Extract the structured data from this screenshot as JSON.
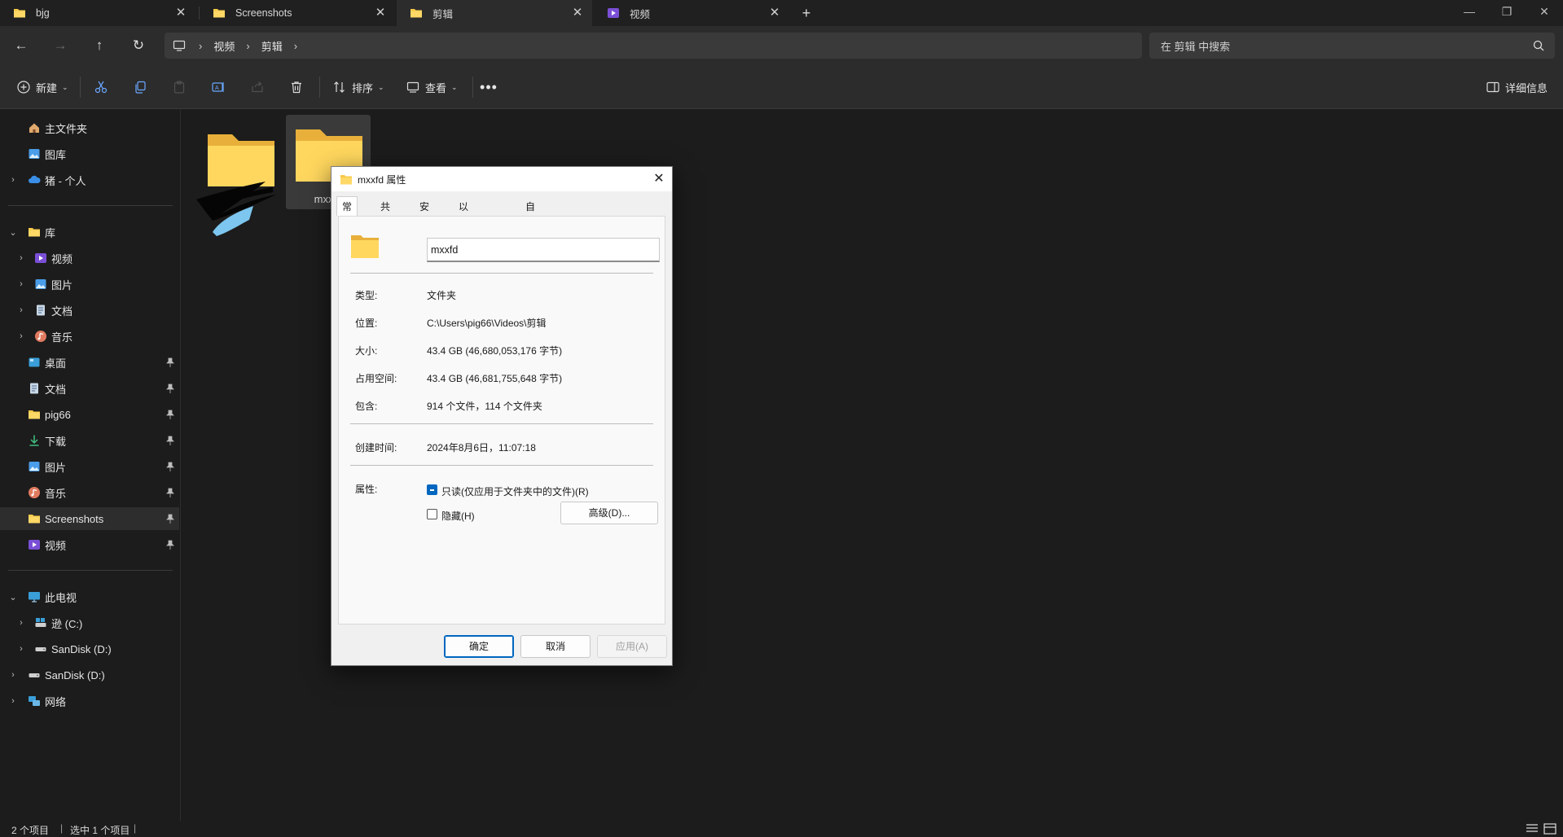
{
  "tabs": [
    {
      "label": "bjg",
      "icon": "folder-icon"
    },
    {
      "label": "Screenshots",
      "icon": "folder-icon"
    },
    {
      "label": "剪辑",
      "icon": "folder-icon"
    },
    {
      "label": "视频",
      "icon": "videos-library-icon"
    }
  ],
  "active_tab_index": 2,
  "breadcrumb": [
    "视频",
    "剪辑"
  ],
  "search": {
    "placeholder": "在 剪辑 中搜索"
  },
  "toolbar": {
    "new_label": "新建",
    "sort_label": "排序",
    "view_label": "查看",
    "details_label": "详细信息"
  },
  "sidebar": {
    "home": "主文件夹",
    "gallery": "图库",
    "onedrive": "猪 - 个人",
    "libraries": "库",
    "lib_items": [
      "视频",
      "图片",
      "文档",
      "音乐"
    ],
    "quick_access": [
      "桌面",
      "文档",
      "pig66",
      "下载",
      "图片",
      "音乐",
      "Screenshots",
      "视频"
    ],
    "this_pc": "此电视",
    "pc_items": [
      "逊 (C:)",
      "SanDisk (D:)"
    ],
    "sandisk": "SanDisk (D:)",
    "network": "网络"
  },
  "files": [
    {
      "name": ""
    },
    {
      "name": "mxxfd"
    }
  ],
  "status": {
    "count": "2 个项目",
    "selected": "选中 1 个项目"
  },
  "dialog": {
    "title": "mxxfd 属性",
    "tabs": [
      "常规",
      "共享",
      "安全",
      "以前的版本",
      "自定义"
    ],
    "active_tab": 0,
    "name_value": "mxxfd",
    "properties": [
      {
        "label": "类型:",
        "value": "文件夹"
      },
      {
        "label": "位置:",
        "value": "C:\\Users\\pig66\\Videos\\剪辑"
      },
      {
        "label": "大小:",
        "value": "43.4 GB (46,680,053,176 字节)"
      },
      {
        "label": "占用空间:",
        "value": "43.4 GB (46,681,755,648 字节)"
      },
      {
        "label": "包含:",
        "value": "914 个文件，114 个文件夹"
      }
    ],
    "created_label": "创建时间:",
    "created_value": "2024年8月6日，11:07:18",
    "attributes_label": "属性:",
    "readonly_label": "只读(仅应用于文件夹中的文件)(R)",
    "readonly_state": "indeterminate",
    "hidden_label": "隐藏(H)",
    "hidden_checked": false,
    "advanced_label": "高级(D)...",
    "ok_label": "确定",
    "cancel_label": "取消",
    "apply_label": "应用(A)"
  },
  "colors": {
    "background": "#1c1c1c",
    "toolbar": "#2c2c2c",
    "accent": "#0067c0",
    "folder_yellow": "#f7c948"
  }
}
